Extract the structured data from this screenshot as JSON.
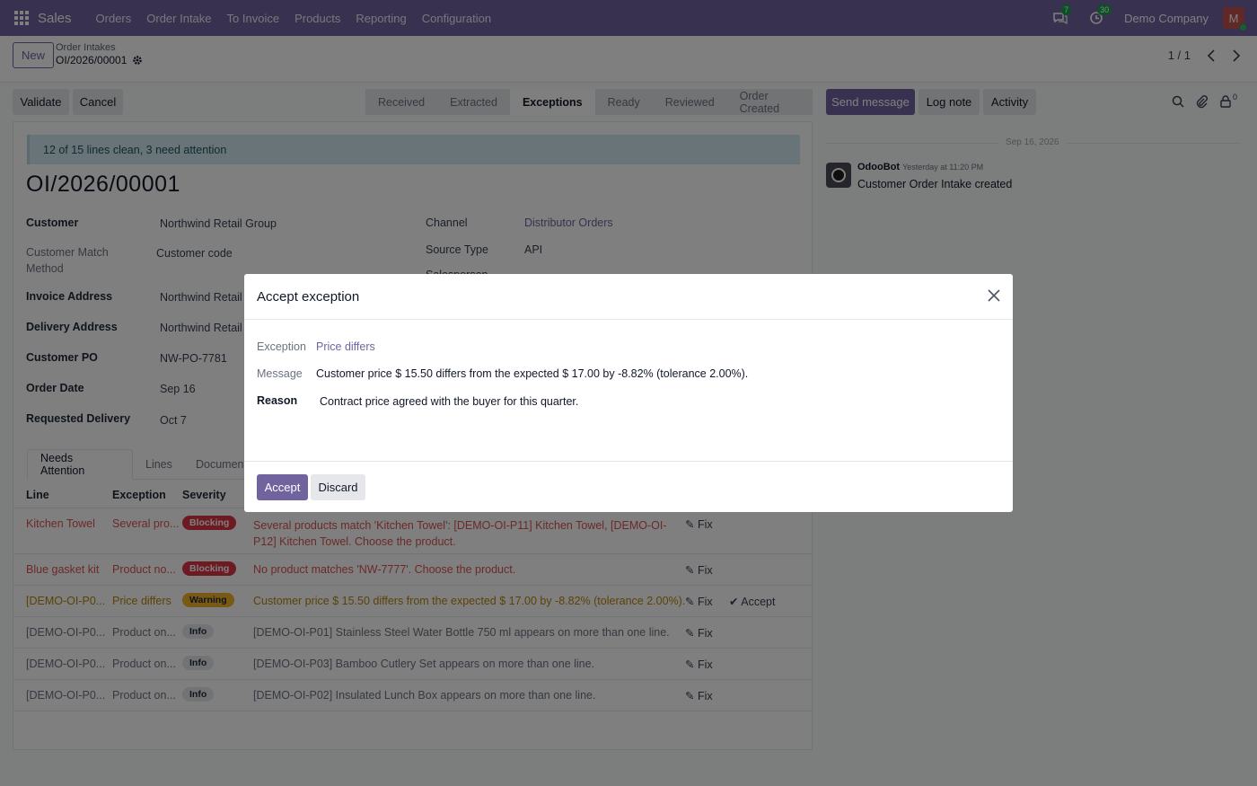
{
  "topbar": {
    "app": "Sales",
    "menu": [
      "Orders",
      "Order Intake",
      "To Invoice",
      "Products",
      "Reporting",
      "Configuration"
    ],
    "messages_count": "7",
    "activities_count": "30",
    "company": "Demo Company",
    "avatar_letter": "M"
  },
  "control": {
    "new_label": "New",
    "breadcrumb_parent": "Order Intakes",
    "breadcrumb_current": "OI/2026/00001",
    "pager": "1 / 1"
  },
  "actions": {
    "validate": "Validate",
    "cancel": "Cancel"
  },
  "statusbar": {
    "stages": [
      "Received",
      "Extracted",
      "Exceptions",
      "Ready",
      "Reviewed",
      "Order Created"
    ],
    "active": "Exceptions"
  },
  "form": {
    "alert": "12 of 15 lines clean, 3 need attention",
    "title": "OI/2026/00001",
    "customer_label": "Customer",
    "customer": "Northwind Retail Group",
    "match_label": "Customer Match Method",
    "match": "Customer code",
    "invoice_label": "Invoice Address",
    "invoice": "Northwind Retail",
    "delivery_label": "Delivery Address",
    "delivery": "Northwind Retail",
    "po_label": "Customer PO",
    "po": "NW-PO-7781",
    "date_label": "Order Date",
    "date": "Sep 16",
    "req_label": "Requested Delivery",
    "req": "Oct 7",
    "channel_label": "Channel",
    "channel": "Distributor Orders",
    "source_label": "Source Type",
    "source": "API",
    "salesperson_label": "Salesperson"
  },
  "tabs": [
    "Needs Attention",
    "Lines",
    "Documents"
  ],
  "table": {
    "headers": [
      "Line",
      "Exception",
      "Severity"
    ],
    "fix": "Fix",
    "accept": "Accept",
    "rows": [
      {
        "line": "Kitchen Towel",
        "exception": "Several pro...",
        "severity": "Blocking",
        "message": "Several products match 'Kitchen Towel': [DEMO-OI-P11] Kitchen Towel, [DEMO-OI-",
        "message2": "P12] Kitchen Towel. Choose the product."
      },
      {
        "line": "Blue gasket kit",
        "exception": "Product no...",
        "severity": "Blocking",
        "message": "No product matches 'NW-7777'. Choose the product.",
        "message2": ""
      },
      {
        "line": "[DEMO-OI-P0...",
        "exception": "Price differs",
        "severity": "Warning",
        "message": "Customer price $ 15.50 differs from the expected $ 17.00 by -8.82% (tolerance 2.00%).",
        "message2": ""
      },
      {
        "line": "[DEMO-OI-P0...",
        "exception": "Product on...",
        "severity": "Info",
        "message": "[DEMO-OI-P01] Stainless Steel Water Bottle 750 ml appears on more than one line.",
        "message2": ""
      },
      {
        "line": "[DEMO-OI-P0...",
        "exception": "Product on...",
        "severity": "Info",
        "message": "[DEMO-OI-P03] Bamboo Cutlery Set appears on more than one line.",
        "message2": ""
      },
      {
        "line": "[DEMO-OI-P0...",
        "exception": "Product on...",
        "severity": "Info",
        "message": "[DEMO-OI-P02] Insulated Lunch Box appears on more than one line.",
        "message2": ""
      }
    ]
  },
  "chatter": {
    "send": "Send message",
    "log": "Log note",
    "activity": "Activity",
    "attachments": "0",
    "date": "Sep 16, 2026",
    "author": "OdooBot",
    "time": "Yesterday at 11:20 PM",
    "body": "Customer Order Intake created"
  },
  "modal": {
    "title": "Accept exception",
    "exception_label": "Exception",
    "exception": "Price differs",
    "message_label": "Message",
    "message": "Customer price $ 15.50 differs from the expected $ 17.00 by -8.82% (tolerance 2.00%).",
    "reason_label": "Reason",
    "reason": "Contract price agreed with the buyer for this quarter.",
    "accept": "Accept",
    "discard": "Discard"
  },
  "colors": {
    "brand": "#71639e",
    "danger": "#d9534f",
    "warning": "#b7850b",
    "blocking": "#dc3545",
    "warning_bg": "#f0b429"
  }
}
